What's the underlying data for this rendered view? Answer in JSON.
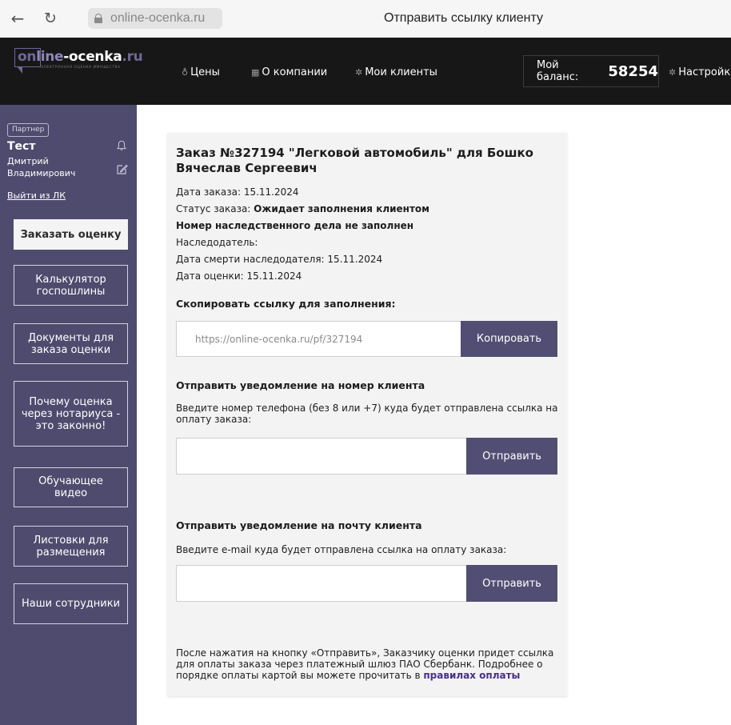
{
  "browser": {
    "url": "online-ocenka.ru",
    "tab_title": "Отправить ссылку клиенту"
  },
  "header": {
    "logo": {
      "on": "on",
      "line": "line",
      "dash": "-",
      "ocenka": "ocenka",
      "ru": ".ru",
      "tagline": "ЭЛЕКТРОННАЯ ОЦЕНКА ИМУЩЕСТВА"
    },
    "nav": {
      "prices": "Цены",
      "company": "О компании",
      "clients": "Мои клиенты",
      "settings": "Настройки"
    },
    "balance_label": "Мой баланс:",
    "balance_value": "58254"
  },
  "sidebar": {
    "badge": "Партнер",
    "user_name": "Тест",
    "user_first": "Дмитрий",
    "user_middle": "Владимирович",
    "logout": "Выйти из ЛК",
    "order_button": "Заказать оценку",
    "items": [
      "Калькулятор госпошлины",
      "Документы для заказа оценки",
      "Почему оценка через нотариуса - это законно!",
      "Обучающее видео",
      "Листовки для размещения",
      "Наши сотрудники"
    ]
  },
  "order": {
    "title": "Заказ №327194 \"Легковой автомобиль\" для Бошко Вячеслав Сергеевич",
    "date_label": "Дата заказа:",
    "date_value": "15.11.2024",
    "status_label": "Статус заказа:",
    "status_value": "Ожидает заполнения клиентом",
    "case_number": "Номер наследственного дела не заполнен",
    "heir_label": "Наследодатель:",
    "death_date_label": "Дата смерти наследодателя:",
    "death_date_value": "15.11.2024",
    "valuation_date_label": "Дата оценки:",
    "valuation_date_value": "15.11.2024"
  },
  "copy_link": {
    "label": "Скопировать ссылку для заполнения:",
    "value": "https://online-ocenka.ru/pf/327194",
    "button": "Копировать"
  },
  "phone_notify": {
    "label": "Отправить уведомление на номер клиента",
    "help": "Введите номер телефона (без 8 или +7) куда будет отправлена ссылка на оплату заказа:",
    "value": "",
    "button": "Отправить"
  },
  "email_notify": {
    "label": "Отправить уведомление на почту клиента",
    "help": "Введите e-mail куда будет отправлена ссылка на оплату заказа:",
    "value": "",
    "button": "Отправить"
  },
  "footer": {
    "text": "После нажатия на кнопку «Отправить», Заказчику оценки придет ссылка для оплаты заказа через платежный шлюз ПАО Сбербанк. Подробнее о порядке оплаты картой вы можете прочитать в",
    "link": "правилах оплаты"
  }
}
